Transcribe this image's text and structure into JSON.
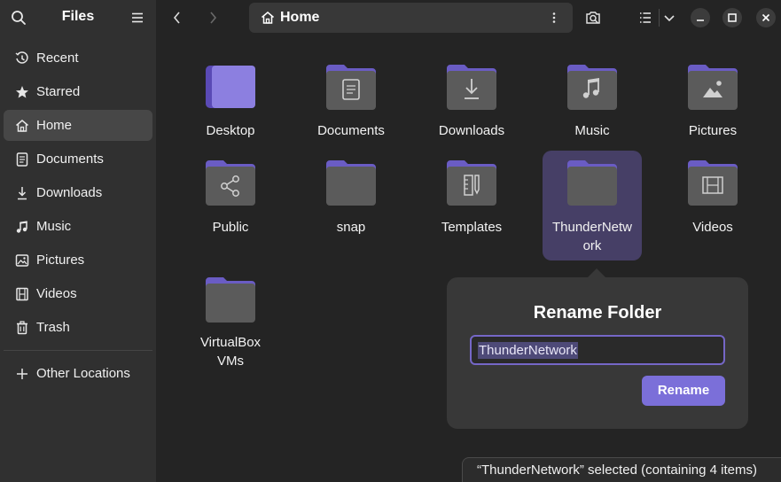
{
  "sidebar": {
    "title": "Files",
    "items": [
      {
        "label": "Recent",
        "icon": "clock-icon",
        "active": false
      },
      {
        "label": "Starred",
        "icon": "star-icon",
        "active": false
      },
      {
        "label": "Home",
        "icon": "home-icon",
        "active": true
      },
      {
        "label": "Documents",
        "icon": "document-icon",
        "active": false
      },
      {
        "label": "Downloads",
        "icon": "download-icon",
        "active": false
      },
      {
        "label": "Music",
        "icon": "music-note-icon",
        "active": false
      },
      {
        "label": "Pictures",
        "icon": "picture-icon",
        "active": false
      },
      {
        "label": "Videos",
        "icon": "film-icon",
        "active": false
      },
      {
        "label": "Trash",
        "icon": "trash-icon",
        "active": false
      }
    ],
    "other_locations": "Other Locations"
  },
  "header": {
    "path": "Home"
  },
  "folders": [
    {
      "label": "Desktop",
      "emblem": "desktop"
    },
    {
      "label": "Documents",
      "emblem": "document"
    },
    {
      "label": "Downloads",
      "emblem": "download"
    },
    {
      "label": "Music",
      "emblem": "music"
    },
    {
      "label": "Pictures",
      "emblem": "picture"
    },
    {
      "label": "Public",
      "emblem": "share"
    },
    {
      "label": "snap",
      "emblem": "none"
    },
    {
      "label": "Templates",
      "emblem": "template"
    },
    {
      "label": "ThunderNetwork",
      "label_lines": [
        "ThunderNetw",
        "ork"
      ],
      "emblem": "none",
      "selected": true
    },
    {
      "label": "Videos",
      "emblem": "film"
    },
    {
      "label": "VirtualBox VMs",
      "label_lines": [
        "VirtualBox",
        "VMs"
      ],
      "emblem": "none"
    }
  ],
  "rename": {
    "title": "Rename Folder",
    "value": "ThunderNetwork",
    "button": "Rename"
  },
  "status": "“ThunderNetwork” selected  (containing 4 items)",
  "colors": {
    "accent": "#7b6fd9",
    "folder_tab": "#6a5cc4",
    "folder_body": "#5b5b5b",
    "selection": "#463f66"
  }
}
